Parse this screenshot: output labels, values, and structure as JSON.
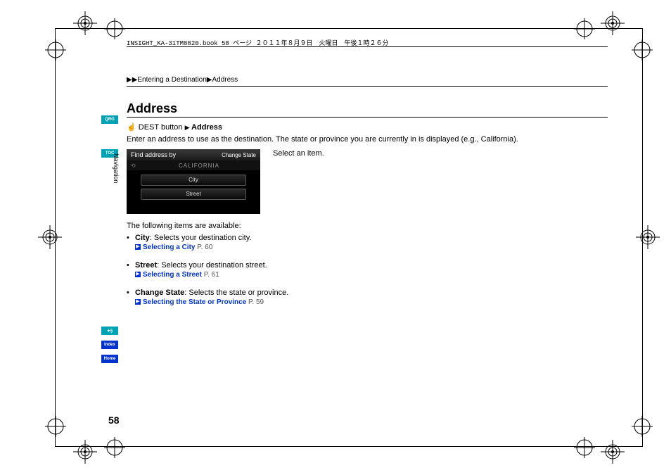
{
  "header_meta": "INSIGHT_KA-31TM8820.book  58 ページ  ２０１１年８月９日　火曜日　午後１時２６分",
  "breadcrumb": {
    "a": "Entering a Destination",
    "b": "Address"
  },
  "section_title": "Address",
  "dest_line": {
    "pre": "DEST button",
    "after": "Address"
  },
  "intro": "Enter an address to use as the destination. The state or province you are currently in is displayed (e.g., California).",
  "select_item": "Select an item.",
  "nav_screen": {
    "title": "Find address by",
    "change_state": "Change State",
    "state": "CALIFORNIA",
    "options": [
      "City",
      "Street"
    ]
  },
  "following": "The following items are available:",
  "items": [
    {
      "label": "City",
      "desc": ": Selects your destination city.",
      "link": "Selecting a City",
      "page": "P. 60"
    },
    {
      "label": "Street",
      "desc": ": Selects your destination street.",
      "link": "Selecting a Street",
      "page": "P. 61"
    },
    {
      "label": "Change State",
      "desc": ": Selects the state or province.",
      "link": "Selecting the State or Province",
      "page": "P. 59"
    }
  ],
  "page_number": "58",
  "tabs": {
    "qrg": "QRG",
    "toc": "TOC",
    "voice": "✦§",
    "index": "Index",
    "home": "Home"
  },
  "vertical_label": "Navigation"
}
